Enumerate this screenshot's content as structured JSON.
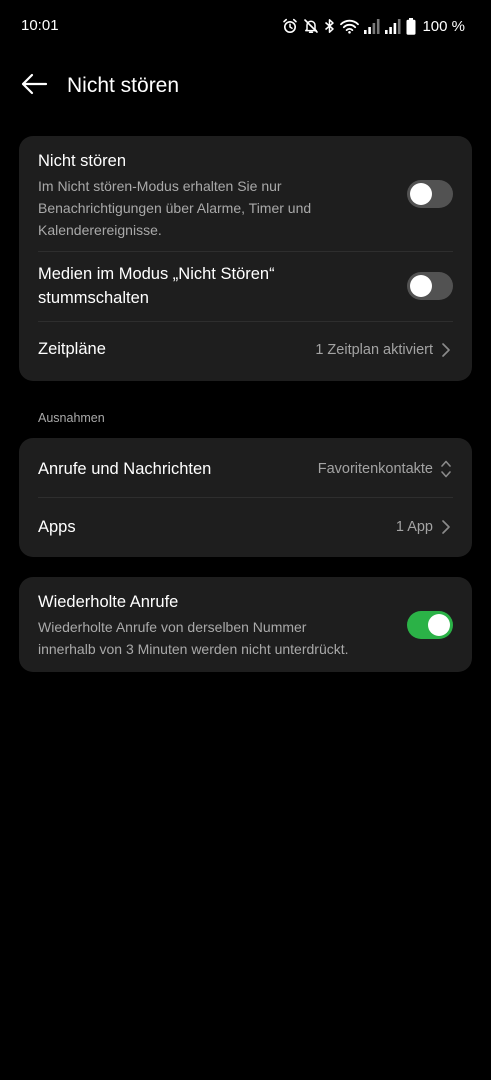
{
  "status_bar": {
    "time": "10:01",
    "battery": "100 %",
    "icons": [
      "alarm-icon",
      "bell-off-icon",
      "bluetooth-icon",
      "wifi-icon",
      "signal-icon",
      "signal-icon",
      "battery-icon"
    ]
  },
  "header": {
    "title": "Nicht stören",
    "back_icon": "arrow-left-icon"
  },
  "card_dnd": {
    "dnd_title": "Nicht stören",
    "dnd_description_line1": "Im Nicht stören-Modus erhalten Sie nur",
    "dnd_description_line2": "Benachrichtigungen über Alarme, Timer und",
    "dnd_description_line3": "Kalenderereignisse.",
    "dnd_enabled": false,
    "mute_media_line1": "Medien im Modus „Nicht Stören“",
    "mute_media_line2": "stummschalten",
    "mute_media_enabled": false,
    "schedules_title": "Zeitpläne",
    "schedules_value": "1 Zeitplan aktiviert"
  },
  "exceptions": {
    "section_label": "Ausnahmen",
    "calls_title": "Anrufe und Nachrichten",
    "calls_value": "Favoritenkontakte",
    "apps_title": "Apps",
    "apps_value": "1 App"
  },
  "card_repeat": {
    "title": "Wiederholte Anrufe",
    "description_line1": "Wiederholte Anrufe von derselben Nummer",
    "description_line2": "innerhalb von 3 Minuten werden nicht unterdrückt.",
    "enabled": true
  },
  "colors": {
    "background": "#000000",
    "card": "#1e1e1e",
    "toggle_on": "#2bb247",
    "toggle_off": "#525252"
  }
}
